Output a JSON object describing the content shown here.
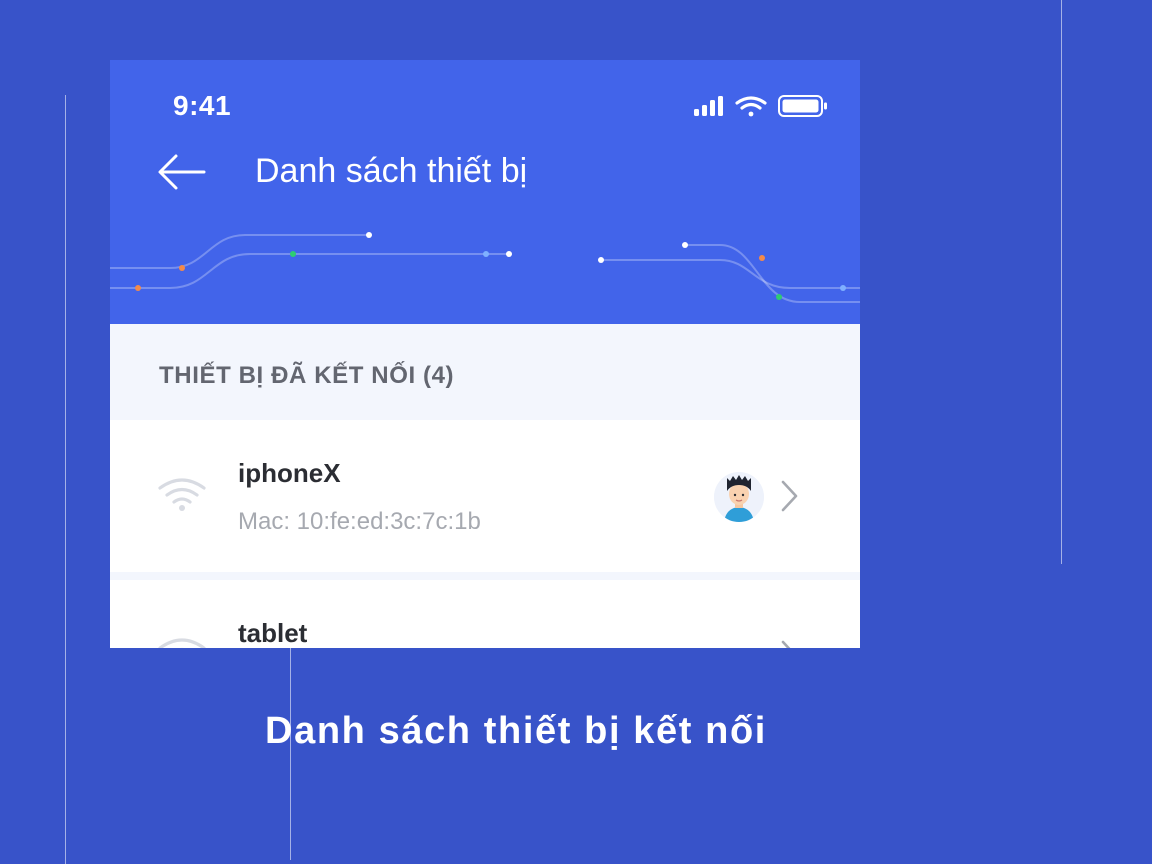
{
  "status_bar": {
    "time": "9:41",
    "icons": [
      "cellular-signal-icon",
      "wifi-icon",
      "battery-icon"
    ]
  },
  "nav": {
    "back_icon": "arrow-left-icon",
    "title": "Danh sách thiết bị"
  },
  "section": {
    "title": "THIẾT BỊ ĐÃ KẾT NỐI (4)"
  },
  "devices": [
    {
      "name": "iphoneX",
      "mac": "Mac: 10:fe:ed:3c:7c:1b",
      "icon": "wifi-icon",
      "has_avatar": true
    },
    {
      "name": "tablet",
      "icon": "wifi-icon"
    }
  ],
  "caption": "Danh sách thiết bị kết nối",
  "colors": {
    "background": "#3853c9",
    "header": "#4264ea",
    "section_bg": "#f3f6fd",
    "text_dark": "#2b2d33",
    "text_muted": "#a6a9b0",
    "dot_orange": "#f48a4a",
    "dot_green": "#2ecc71",
    "dot_blue": "#7fb0ff"
  }
}
